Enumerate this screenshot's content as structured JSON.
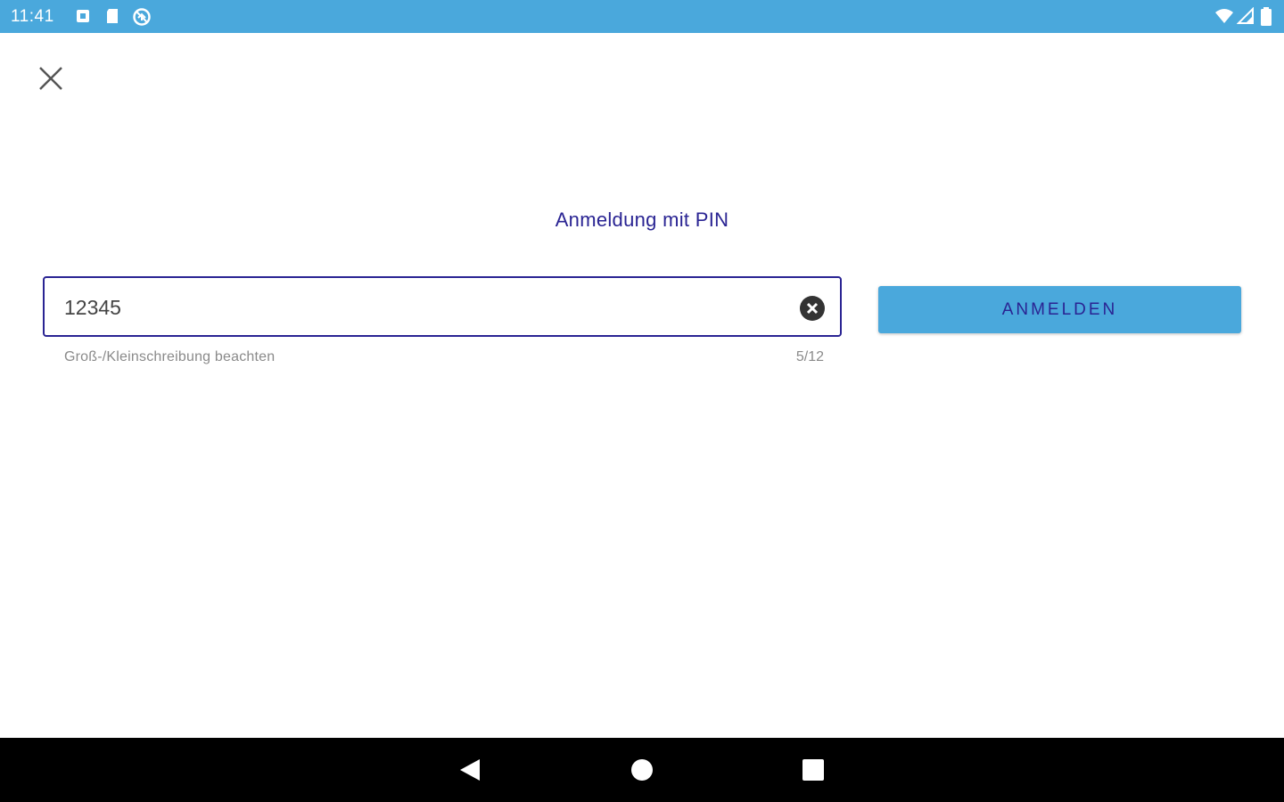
{
  "status_bar": {
    "time": "11:41",
    "background_color": "#4aa8dc",
    "left_icons": [
      "notification-icon",
      "sd-card-icon",
      "sync-icon"
    ],
    "right_icons": [
      "wifi-icon",
      "signal-icon",
      "battery-icon"
    ]
  },
  "dialog": {
    "close_icon": "close-icon",
    "title": "Anmeldung mit PIN",
    "pin_input": {
      "value": "12345",
      "helper_text": "Groß-/Kleinschreibung beachten",
      "counter": "5/12",
      "clear_icon": "clear-icon"
    },
    "login_button_label": "ANMELDEN"
  },
  "theme": {
    "accent": "#2a2493",
    "primary": "#4aa8dc"
  },
  "nav_bar": {
    "icons": [
      "back-icon",
      "home-icon",
      "recents-icon"
    ]
  }
}
